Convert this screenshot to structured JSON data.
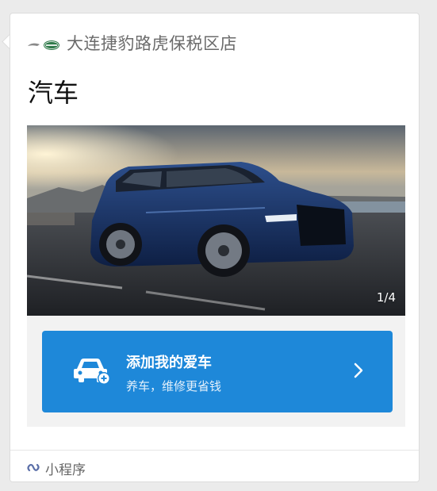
{
  "header": {
    "store_name": "大连捷豹路虎保税区店",
    "logo_icon": "jaguar-landrover-logo"
  },
  "page_title": "汽车",
  "hero": {
    "page_counter": "1/4",
    "image_subject": "blue-suv-on-road"
  },
  "banner": {
    "title": "添加我的爱车",
    "subtitle": "养车，维修更省钱",
    "icon": "car-add-icon",
    "action_icon": "chevron-right-icon",
    "color": "#1e88d9"
  },
  "footer": {
    "label": "小程序",
    "icon": "mini-program-icon",
    "icon_color": "#5b6fa8"
  }
}
